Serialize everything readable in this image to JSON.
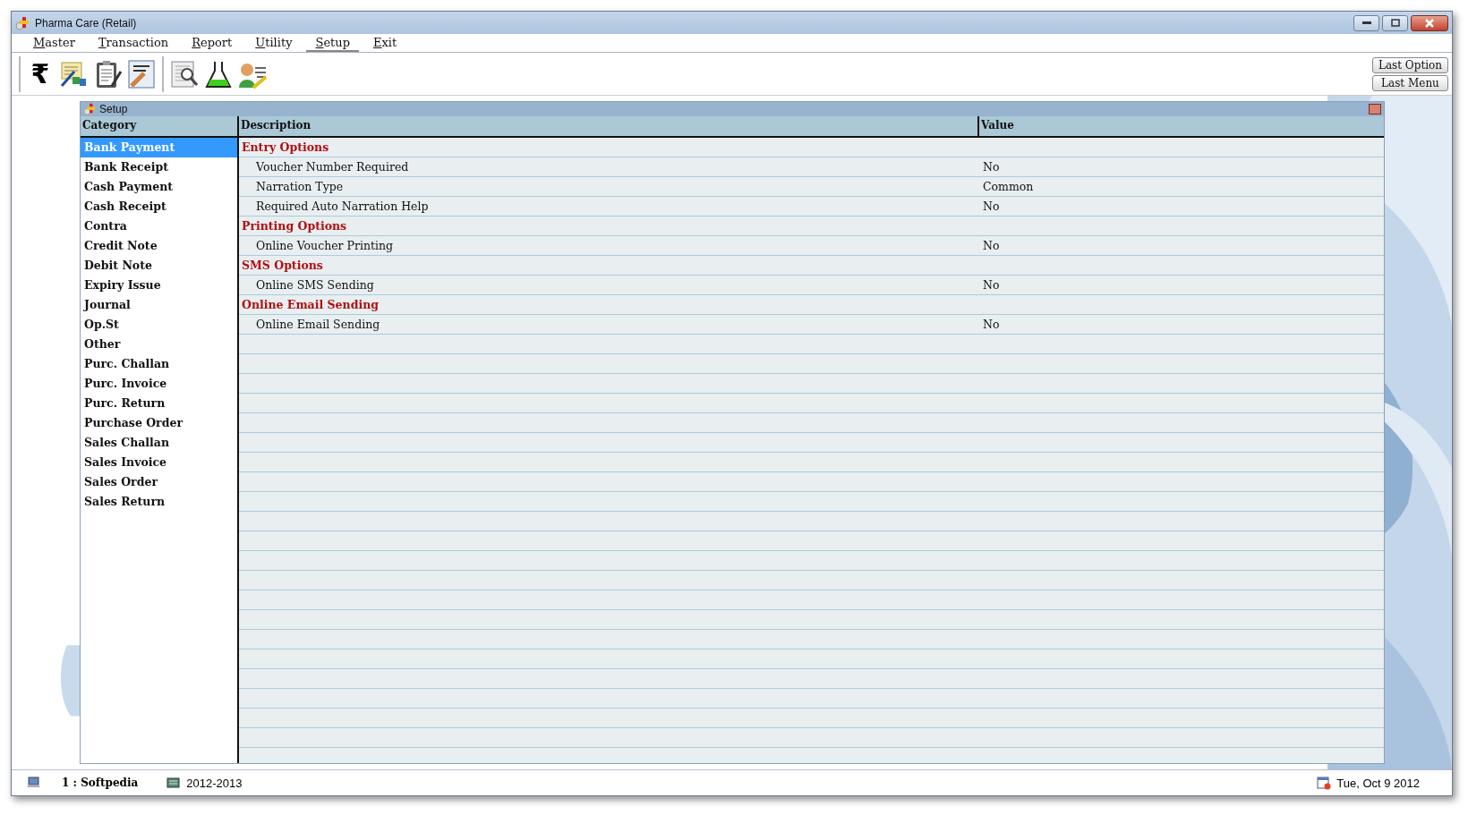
{
  "window": {
    "title": "Pharma Care (Retail)"
  },
  "menu": [
    {
      "label": "Master",
      "selected": false
    },
    {
      "label": "Transaction",
      "selected": false
    },
    {
      "label": "Report",
      "selected": false
    },
    {
      "label": "Utility",
      "selected": false
    },
    {
      "label": "Setup",
      "selected": true
    },
    {
      "label": "Exit",
      "selected": false
    }
  ],
  "toolbar": {
    "currency_symbol": "₹"
  },
  "side_buttons": [
    "Last Option",
    "Last Menu"
  ],
  "setup_window": {
    "title": "Setup",
    "columns": [
      "Category",
      "Description",
      "Value"
    ],
    "categories": [
      {
        "label": "Bank Payment",
        "selected": true
      },
      {
        "label": "Bank Receipt",
        "selected": false
      },
      {
        "label": "Cash Payment",
        "selected": false
      },
      {
        "label": "Cash Receipt",
        "selected": false
      },
      {
        "label": "Contra",
        "selected": false
      },
      {
        "label": "Credit Note",
        "selected": false
      },
      {
        "label": "Debit Note",
        "selected": false
      },
      {
        "label": "Expiry Issue",
        "selected": false
      },
      {
        "label": "Journal",
        "selected": false
      },
      {
        "label": "Op.St",
        "selected": false
      },
      {
        "label": "Other",
        "selected": false
      },
      {
        "label": "Purc. Challan",
        "selected": false
      },
      {
        "label": "Purc. Invoice",
        "selected": false
      },
      {
        "label": "Purc. Return",
        "selected": false
      },
      {
        "label": "Purchase Order",
        "selected": false
      },
      {
        "label": "Sales Challan",
        "selected": false
      },
      {
        "label": "Sales Invoice",
        "selected": false
      },
      {
        "label": "Sales Order",
        "selected": false
      },
      {
        "label": "Sales Return",
        "selected": false
      }
    ],
    "options": [
      {
        "kind": "section",
        "label": "Entry Options"
      },
      {
        "kind": "option",
        "label": "Voucher Number Required",
        "value": "No"
      },
      {
        "kind": "option",
        "label": "Narration Type",
        "value": "Common"
      },
      {
        "kind": "option",
        "label": "Required Auto Narration Help",
        "value": "No"
      },
      {
        "kind": "section",
        "label": "Printing Options"
      },
      {
        "kind": "option",
        "label": "Online Voucher Printing",
        "value": "No"
      },
      {
        "kind": "section",
        "label": "SMS Options"
      },
      {
        "kind": "option",
        "label": "Online SMS Sending",
        "value": "No"
      },
      {
        "kind": "section",
        "label": "Online Email Sending"
      },
      {
        "kind": "option",
        "label": "Online Email Sending",
        "value": "No"
      }
    ]
  },
  "status_bar": {
    "user": "1 : Softpedia",
    "year": "2012-2013",
    "date": "Tue, Oct 9 2012"
  }
}
